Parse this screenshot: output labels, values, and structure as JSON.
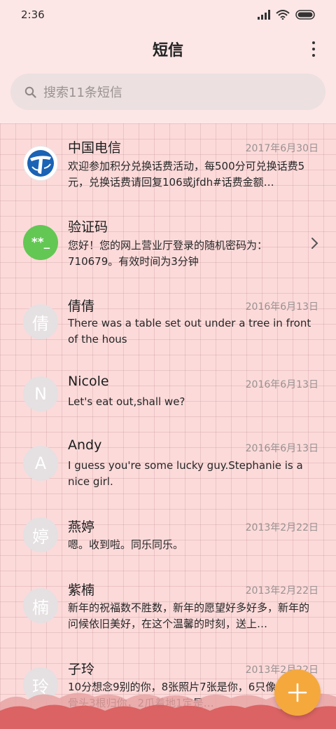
{
  "status_bar": {
    "time": "2:36"
  },
  "header": {
    "title": "短信",
    "menu_icon": "more-vertical-icon"
  },
  "search": {
    "placeholder": "搜索11条短信",
    "icon": "search-icon"
  },
  "messages": [
    {
      "name": "中国电信",
      "date": "2017年6月30日",
      "preview": "欢迎参加积分兑换话费活动，每500分可兑换话费5元，兑换话费请回复106或jfdh#话费金额…",
      "avatar_icon": "china-telecom-logo"
    },
    {
      "name": "验证码",
      "date": "",
      "preview": "您好！您的网上营业厅登录的随机密码为：710679。有效时间为3分钟",
      "avatar_text": "**_"
    },
    {
      "name": "倩倩",
      "date": "2016年6月13日",
      "preview": "There was a table set out under a tree in front of the hous",
      "avatar_text": "倩"
    },
    {
      "name": "Nicole",
      "date": "2016年6月13日",
      "preview": "Let's eat out,shall we?",
      "avatar_text": "N"
    },
    {
      "name": "Andy",
      "date": "2016年6月13日",
      "preview": "I guess you're some lucky guy.Stephanie is a nice girl.",
      "avatar_text": "A"
    },
    {
      "name": "燕婷",
      "date": "2013年2月22日",
      "preview": "嗯。收到啦。同乐同乐。",
      "avatar_text": "婷"
    },
    {
      "name": "紫楠",
      "date": "2013年2月22日",
      "preview": "新年的祝福数不胜数，新年的愿望好多好多，新年的问候依旧美好，在这个温馨的时刻，送上…",
      "avatar_text": "楠"
    },
    {
      "name": "子玲",
      "date": "2013年2月22日",
      "preview": "10分想念9别的你，8张照片7张是你，6只像你，4根骨头3根归你，2爪着地1定是…",
      "avatar_text": "玲"
    }
  ],
  "fab": {
    "icon": "plus-icon"
  },
  "colors": {
    "fab": "#f5a93d",
    "code_avatar": "#63c754",
    "background": "#fcdada"
  }
}
